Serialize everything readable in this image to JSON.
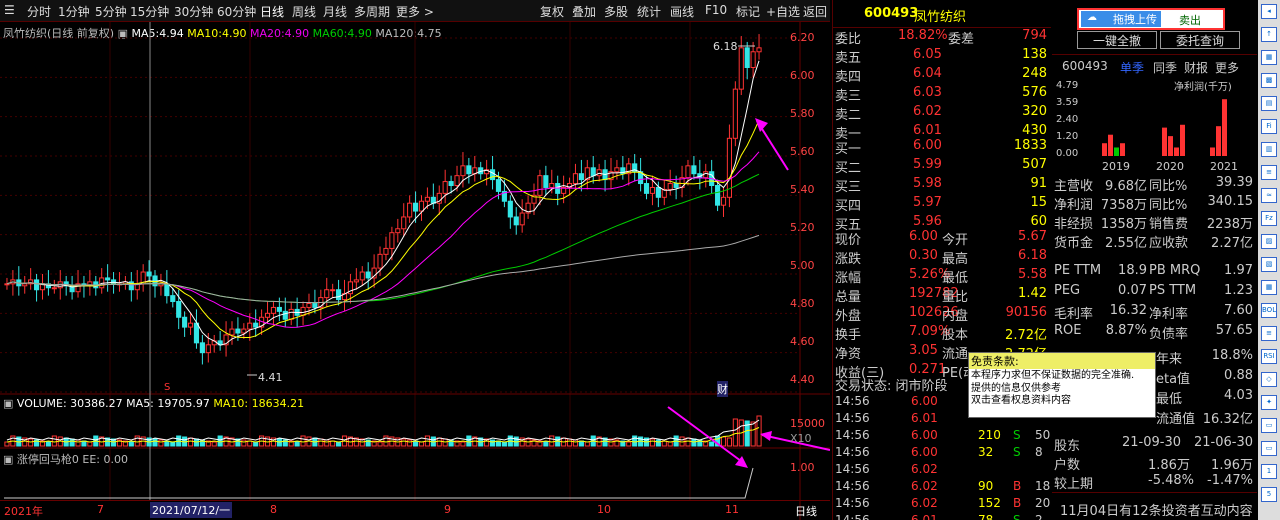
{
  "toolbar": {
    "periods": [
      "分时",
      "1分钟",
      "5分钟",
      "15分钟",
      "30分钟",
      "60分钟",
      "日线",
      "周线",
      "月线",
      "多周期",
      "更多 >"
    ],
    "active": "日线",
    "tools": [
      "复权",
      "叠加",
      "多股",
      "统计",
      "画线",
      "F10",
      "标记",
      "+自选",
      "返回"
    ]
  },
  "chart": {
    "title": "凤竹纺织(日线 前复权)",
    "ma": [
      {
        "label": "MA5:",
        "value": "4.94"
      },
      {
        "label": "MA10:",
        "value": "4.90"
      },
      {
        "label": "MA20:",
        "value": "4.90"
      },
      {
        "label": "MA60:",
        "value": "4.90"
      },
      {
        "label": "MA120:",
        "value": "4.75"
      }
    ],
    "high_label": "6.18",
    "low_label": "4.41",
    "marker_s": "S",
    "marker_cai": "财",
    "price_axis": [
      "6.20",
      "6.00",
      "5.80",
      "5.60",
      "5.40",
      "5.20",
      "5.00",
      "4.80",
      "4.60",
      "4.40"
    ],
    "x_labels": [
      "2021年",
      "7",
      "2021/07/12/一",
      "8",
      "9",
      "10",
      "11"
    ],
    "x_right": "日线"
  },
  "volume": {
    "label": "VOLUME: 30386.27",
    "ma5": "MA5: 19705.97",
    "ma10": "MA10: 18634.21",
    "axis": [
      "15000",
      "X10"
    ]
  },
  "indicator": {
    "label": "涨停回马枪0  EE: 0.00",
    "axis": "1.00"
  },
  "quote": {
    "code": "600493",
    "name": "凤竹纺织",
    "weibi_label": "委比",
    "weibi": "18.82%",
    "weicha_label": "委差",
    "weicha": "794",
    "asks": [
      {
        "l": "卖五",
        "p": "6.05",
        "v": "138"
      },
      {
        "l": "卖四",
        "p": "6.04",
        "v": "248"
      },
      {
        "l": "卖三",
        "p": "6.03",
        "v": "576"
      },
      {
        "l": "卖二",
        "p": "6.02",
        "v": "320"
      },
      {
        "l": "卖一",
        "p": "6.01",
        "v": "430"
      }
    ],
    "bids": [
      {
        "l": "买一",
        "p": "6.00",
        "v": "1833"
      },
      {
        "l": "买二",
        "p": "5.99",
        "v": "507"
      },
      {
        "l": "买三",
        "p": "5.98",
        "v": "91"
      },
      {
        "l": "买四",
        "p": "5.97",
        "v": "15"
      },
      {
        "l": "买五",
        "p": "5.96",
        "v": "60"
      }
    ],
    "stats": [
      {
        "a": "现价",
        "b": "6.00",
        "c": "今开",
        "d": "5.67"
      },
      {
        "a": "涨跌",
        "b": "0.30",
        "c": "最高",
        "d": "6.18"
      },
      {
        "a": "涨幅",
        "b": "5.26%",
        "c": "最低",
        "d": "5.58"
      },
      {
        "a": "总量",
        "b": "192782",
        "c": "量比",
        "d": "1.42"
      },
      {
        "a": "外盘",
        "b": "102626",
        "c": "内盘",
        "d": "90156"
      },
      {
        "a": "换手",
        "b": "7.09%",
        "c": "股本",
        "d": "2.72亿"
      },
      {
        "a": "净资",
        "b": "3.05",
        "c": "流通",
        "d": "2.72亿"
      },
      {
        "a": "收益(三)",
        "b": "0.271",
        "c": "PE(动)",
        "d": ""
      }
    ],
    "trade_state": "交易状态: 闭市阶段",
    "ticks": [
      {
        "t": "14:56",
        "p": "6.00",
        "v": "",
        "f": ""
      },
      {
        "t": "14:56",
        "p": "6.01",
        "v": "",
        "f": ""
      },
      {
        "t": "14:56",
        "p": "6.00",
        "v": "210",
        "f": "S",
        "n": "50"
      },
      {
        "t": "14:56",
        "p": "6.00",
        "v": "32",
        "f": "S",
        "n": "8"
      },
      {
        "t": "14:56",
        "p": "6.02",
        "v": "",
        "f": ""
      },
      {
        "t": "14:56",
        "p": "6.02",
        "v": "90",
        "f": "B",
        "n": "18"
      },
      {
        "t": "14:56",
        "p": "6.02",
        "v": "152",
        "f": "B",
        "n": "20"
      },
      {
        "t": "14:56",
        "p": "6.01",
        "v": "78",
        "f": "S",
        "n": "2"
      }
    ]
  },
  "disclaimer": {
    "title": "免责条款:",
    "lines": [
      "本程序力求但不保证数据的完全准确.",
      "提供的信息仅供参考",
      "双击查看权息资料内容"
    ]
  },
  "side": {
    "upload": "拖拽上传",
    "sell": "卖出",
    "one_click": "一键全撤",
    "query": "委托查询",
    "code": "600493",
    "tabs": [
      "单季",
      "同季",
      "财报",
      "更多"
    ],
    "yaxis": [
      "4.79",
      "3.59",
      "2.40",
      "1.20",
      "0.00"
    ],
    "unit": "净利润(千万)",
    "years": [
      "2019",
      "2020",
      "2021"
    ],
    "fin": [
      {
        "a": "主营收",
        "b": "9.68亿",
        "c": "同比%",
        "d": "39.39"
      },
      {
        "a": "净利润",
        "b": "7358万",
        "c": "同比%",
        "d": "340.15"
      },
      {
        "a": "非经损",
        "b": "1358万",
        "c": "销售费",
        "d": "2238万"
      },
      {
        "a": "货币金",
        "b": "2.55亿",
        "c": "应收款",
        "d": "2.27亿"
      },
      {
        "a": "PE TTM",
        "b": "18.9",
        "c": "PB MRQ",
        "d": "1.97"
      },
      {
        "a": "PEG",
        "b": "0.07",
        "c": "PS TTM",
        "d": "1.23"
      },
      {
        "a": "毛利率",
        "b": "16.32",
        "c": "净利率",
        "d": "7.60"
      },
      {
        "a": "ROE",
        "b": "8.87%",
        "c": "负债率",
        "d": "57.65"
      }
    ],
    "fin2": [
      {
        "a": "年来",
        "b": "18.8%"
      },
      {
        "a": "eta值",
        "b": "0.88"
      },
      {
        "a": "最低",
        "b": "4.03"
      },
      {
        "a": "流通值",
        "b": "16.32亿"
      }
    ],
    "holders": {
      "h": "股东",
      "d1": "21-09-30",
      "d2": "21-06-30",
      "r1": "户数",
      "v1": "1.86万",
      "v2": "1.96万",
      "r2": "较上期",
      "p1": "-5.48%",
      "p2": "-1.47%"
    },
    "note": "11月04日有12条投资者互动内容"
  },
  "chart_data": {
    "type": "candlestick",
    "ylim": [
      4.4,
      6.2
    ],
    "high": "6.18",
    "low": "4.41",
    "last_close": "6.00",
    "ma": {
      "MA5": 4.94,
      "MA10": 4.9,
      "MA20": 4.9,
      "MA60": 4.9,
      "MA120": 4.75
    }
  },
  "colors": {
    "up": "#ff3333",
    "down": "#33e6e6",
    "ma5": "#ffffff",
    "ma10": "#ffff00",
    "ma20": "#ff00ff",
    "ma60": "#00cc00",
    "ma120": "#aaaaaa"
  }
}
